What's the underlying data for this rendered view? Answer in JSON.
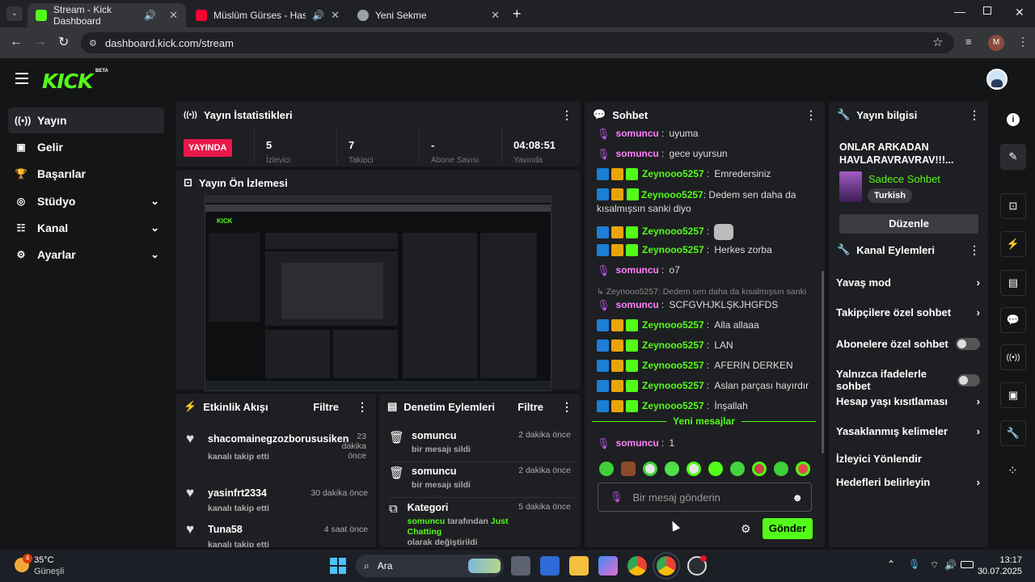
{
  "browser": {
    "tabs": [
      {
        "title": "Stream - Kick Dashboard"
      },
      {
        "title": "Müslüm Gürses - Hasret Rü"
      },
      {
        "title": "Yeni Sekme"
      }
    ],
    "url": "dashboard.kick.com/stream",
    "profile_initial": "M"
  },
  "app": {
    "logo": "KICK",
    "beta": "BETA"
  },
  "sidebar": {
    "items": [
      {
        "label": "Yayın"
      },
      {
        "label": "Gelir"
      },
      {
        "label": "Başarılar"
      },
      {
        "label": "Stüdyo"
      },
      {
        "label": "Kanal"
      },
      {
        "label": "Ayarlar"
      }
    ]
  },
  "stats": {
    "title": "Yayın İstatistikleri",
    "live": "YAYINDA",
    "viewers": "5",
    "viewers_label": "İzleyici",
    "followers": "7",
    "followers_label": "Takipçi",
    "subs": "-",
    "subs_label": "Abone Sayısı",
    "duration": "04:08:51",
    "duration_label": "Yayında"
  },
  "preview": {
    "title": "Yayın Ön İzlemesi"
  },
  "activity": {
    "title": "Etkinlik Akışı",
    "filter": "Filtre",
    "items": [
      {
        "user": "shacomainegzozborususiken",
        "text": "kanalı takip etti",
        "time": "23 dakika önce"
      },
      {
        "user": "yasinfrt2334",
        "text": "kanalı takip etti",
        "time": "30 dakika önce"
      },
      {
        "user": "Tuna58",
        "text": "kanalı takip etti",
        "time": "4 saat önce"
      }
    ]
  },
  "moderation": {
    "title": "Denetim Eylemleri",
    "filter": "Filtre",
    "items": [
      {
        "user": "somuncu",
        "text": "bir mesajı sildi",
        "time": "2 dakika önce"
      },
      {
        "user": "somuncu",
        "text": "bir mesajı sildi",
        "time": "2 dakika önce"
      },
      {
        "user": "Kategori",
        "time": "5 dakika önce",
        "line1a": "somuncu",
        "line1b": " tarafından ",
        "line1c": "Just Chatting",
        "line2": "olarak değiştirildi"
      }
    ]
  },
  "chat": {
    "title": "Sohbet",
    "new_messages": "Yeni mesajlar",
    "placeholder": "Bir mesaj gönderin",
    "send": "Gönder",
    "messages": [
      {
        "user": "somuncu",
        "text": "uyuma"
      },
      {
        "user": "somuncu",
        "text": "gece uyursun"
      },
      {
        "user": "Zeynooo5257",
        "text": "Emredersiniz"
      },
      {
        "user": "Zeynooo5257",
        "text": "Dedem sen daha da kısalmışsın sanki diyo"
      },
      {
        "user": "Zeynooo5257",
        "text": ""
      },
      {
        "user": "Zeynooo5257",
        "text": "Herkes zorba"
      },
      {
        "user": "somuncu",
        "text": "o7"
      },
      {
        "reply": "Zeynooo5257: Dedem sen daha da kısalmışsın sanki diyo",
        "user": "somuncu",
        "text": "SCFGVHJKLŞKJHGFDS"
      },
      {
        "user": "Zeynooo5257",
        "text": "Alla allaaa"
      },
      {
        "user": "Zeynooo5257",
        "text": "LAN"
      },
      {
        "user": "Zeynooo5257",
        "text": "AFERİN DERKEN"
      },
      {
        "user": "Zeynooo5257",
        "text": "Aslan parçası hayırdır"
      },
      {
        "user": "Zeynooo5257",
        "text": "İnşallah"
      },
      {
        "user": "somuncu",
        "text": "1"
      }
    ]
  },
  "info": {
    "title": "Yayın bilgisi",
    "stream_title": "ONLAR ARKADAN HAVLARAVRAVRAV!!!...",
    "category": "Sadece Sohbet",
    "tag": "Turkish",
    "edit": "Düzenle"
  },
  "channel_actions": {
    "title": "Kanal Eylemleri",
    "items": [
      {
        "label": "Yavaş mod",
        "kind": "chevron"
      },
      {
        "label": "Takipçilere özel sohbet",
        "kind": "chevron"
      },
      {
        "label": "Abonelere özel sohbet",
        "kind": "toggle"
      },
      {
        "label": "Yalnızca ifadelerle sohbet",
        "kind": "toggle"
      },
      {
        "label": "Hesap yaşı kısıtlaması",
        "kind": "chevron"
      },
      {
        "label": "Yasaklanmış kelimeler",
        "kind": "chevron"
      },
      {
        "label": "İzleyici Yönlendir",
        "kind": "none"
      },
      {
        "label": "Hedefleri belirleyin",
        "kind": "chevron"
      }
    ]
  },
  "taskbar": {
    "weather_temp": "35°C",
    "weather_desc": "Güneşli",
    "weather_badge": "4",
    "search": "Ara",
    "time": "13:17",
    "date": "30.07.2025"
  }
}
